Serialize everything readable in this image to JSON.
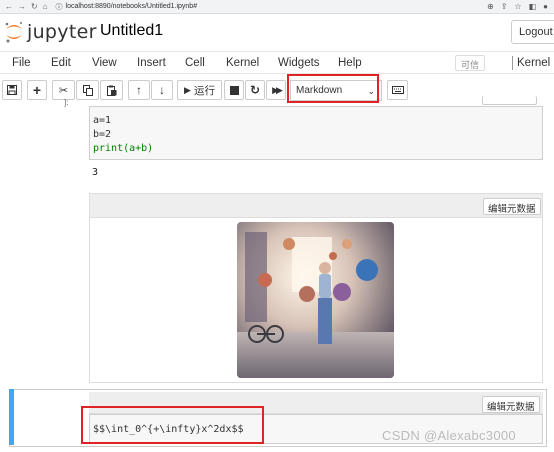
{
  "browser": {
    "url": "localhost:8890/notebooks/Untitled1.ipynb#"
  },
  "header": {
    "logo_text": "jupyter",
    "notebook_title": "Untitled1",
    "logout_label": "Logout"
  },
  "menu": {
    "items": [
      "File",
      "Edit",
      "View",
      "Insert",
      "Cell",
      "Kernel",
      "Widgets",
      "Help"
    ],
    "trusted_label": "可信",
    "kernel_label": "Kernel"
  },
  "toolbar": {
    "run_label": "运行",
    "cell_type_value": "Markdown"
  },
  "cells": {
    "code_lines": [
      "a=1",
      "b=2",
      "print(a+b)"
    ],
    "output": "3",
    "metadata_button_label": "编辑元数据",
    "markdown_source": "$$\\int_0^{+\\infty}x^2dx$$"
  },
  "watermark": "CSDN @Alexabc3000",
  "colors": {
    "selected_cell_bar": "#42a5f5",
    "highlight_box": "#e02424",
    "jupyter_orange": "#f37726"
  }
}
